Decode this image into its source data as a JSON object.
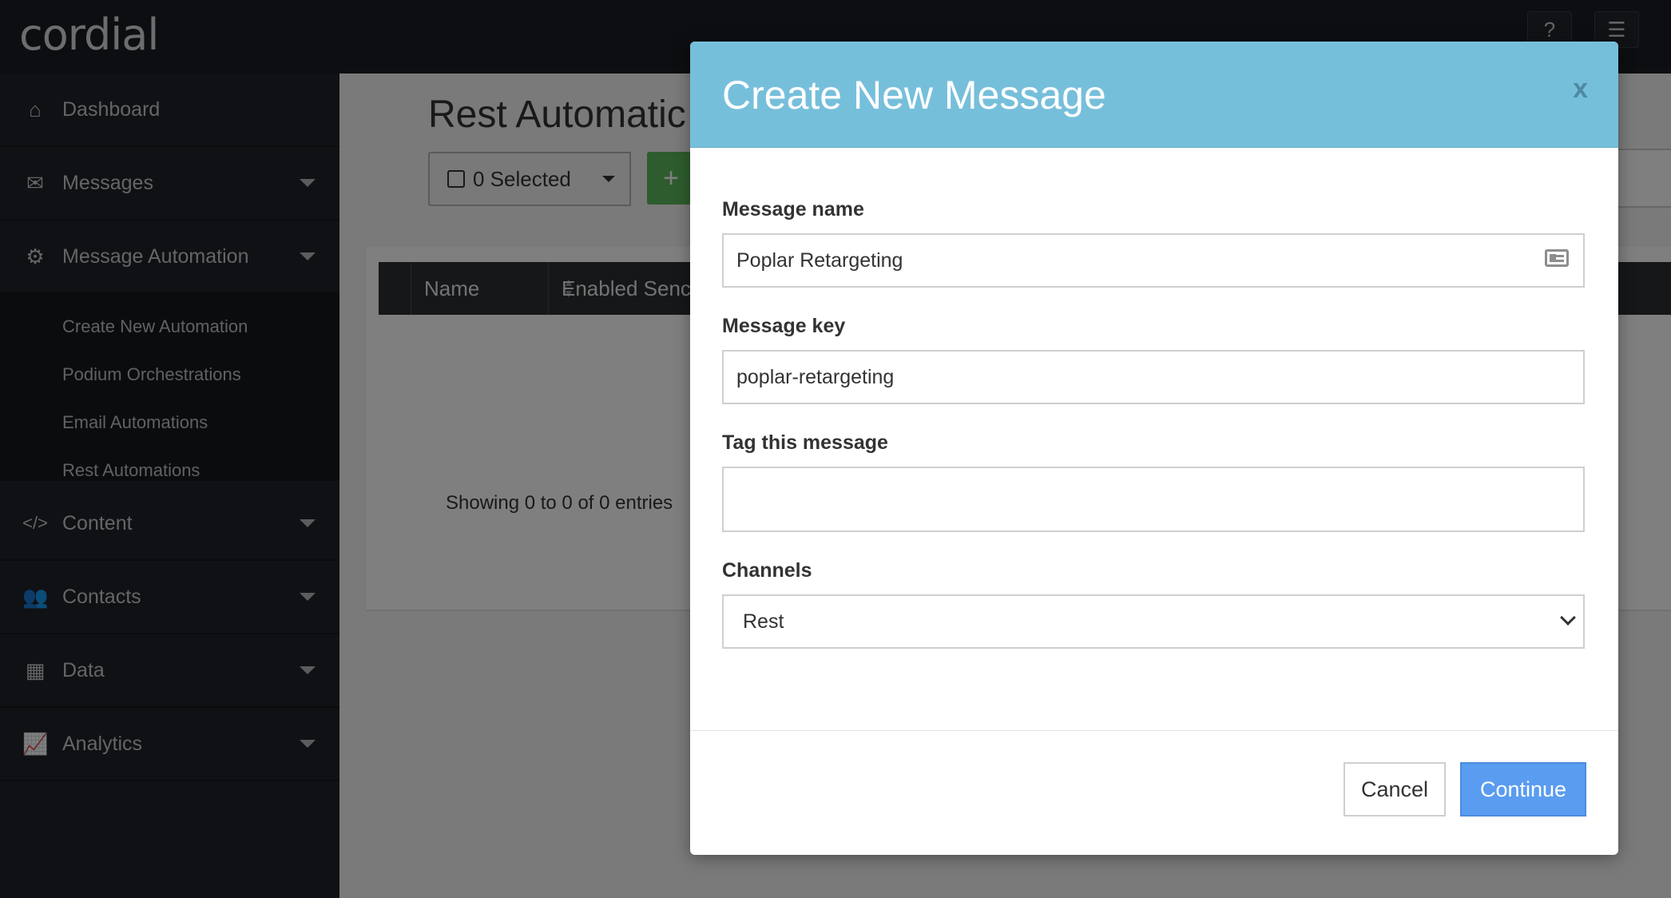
{
  "app": {
    "logo": "cordial"
  },
  "topbar": {
    "help_icon": "question-circle-icon",
    "menu_icon": "server-icon"
  },
  "sidebar": {
    "items": [
      {
        "label": "Dashboard",
        "icon": "home-icon"
      },
      {
        "label": "Messages",
        "icon": "envelope-icon"
      },
      {
        "label": "Message Automation",
        "icon": "gears-icon"
      },
      {
        "label": "Content",
        "icon": "code-icon"
      },
      {
        "label": "Contacts",
        "icon": "users-icon"
      },
      {
        "label": "Data",
        "icon": "table-icon"
      },
      {
        "label": "Analytics",
        "icon": "line-chart-icon"
      }
    ],
    "submenu": [
      "Create New Automation",
      "Podium Orchestrations",
      "Email Automations",
      "Rest Automations"
    ]
  },
  "main": {
    "title": "Rest Automatic",
    "selected_label": "0 Selected",
    "table_headers": [
      "Name",
      "Enabled Senc"
    ],
    "showing": "Showing 0 to 0 of 0 entries"
  },
  "modal": {
    "title": "Create New Message",
    "close": "x",
    "fields": {
      "message_name": {
        "label": "Message name",
        "value": "Poplar Retargeting"
      },
      "message_key": {
        "label": "Message key",
        "value": "poplar-retargeting"
      },
      "tag": {
        "label": "Tag this message",
        "value": ""
      },
      "channels": {
        "label": "Channels",
        "value": "Rest"
      }
    },
    "buttons": {
      "cancel": "Cancel",
      "continue": "Continue"
    }
  }
}
